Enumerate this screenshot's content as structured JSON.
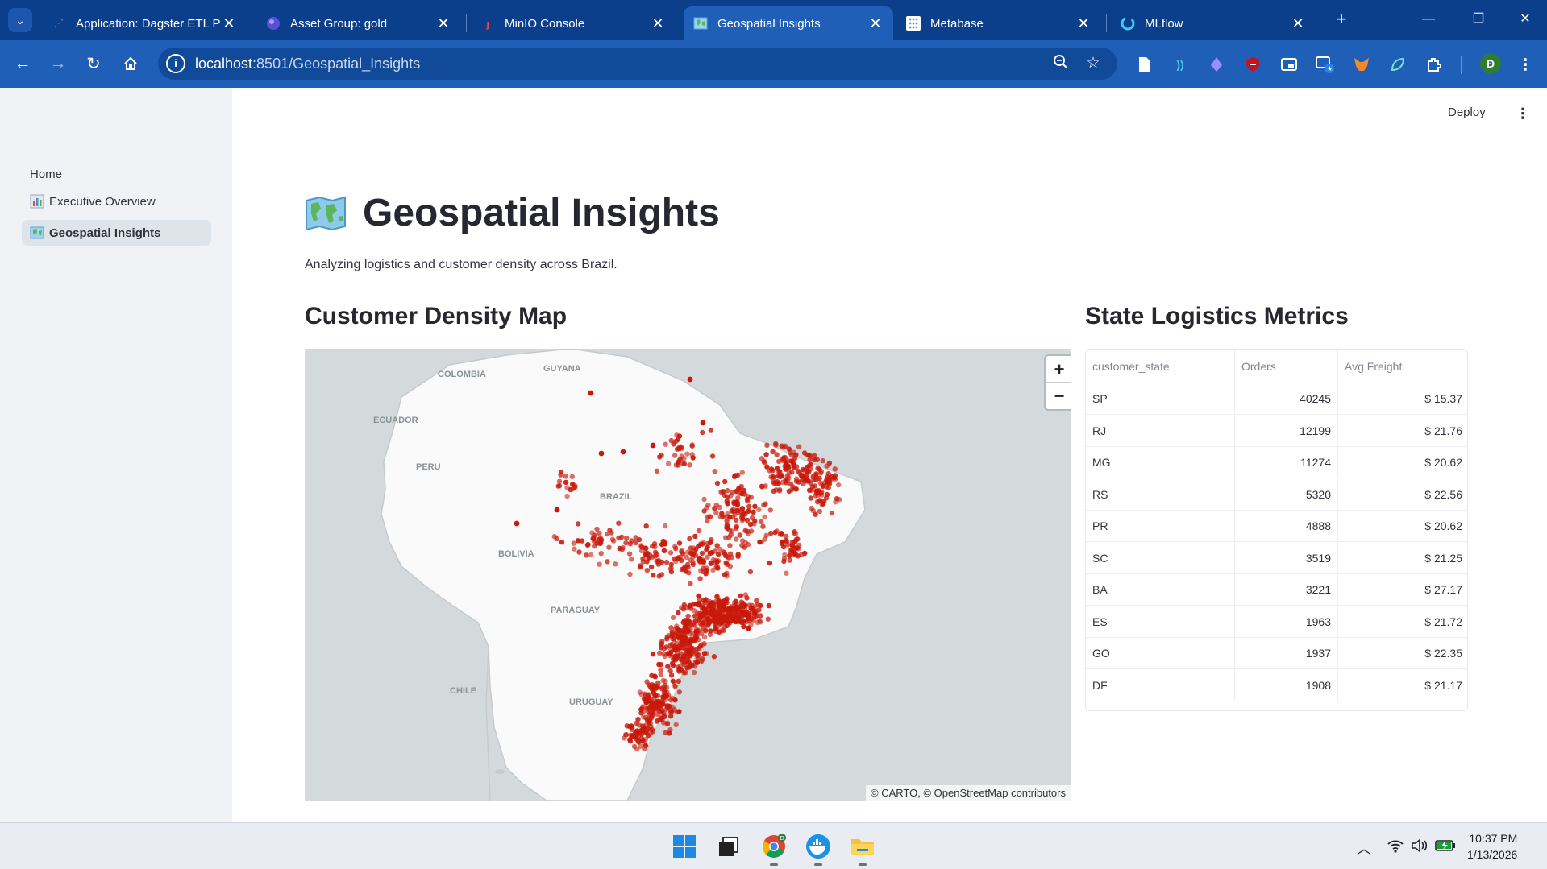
{
  "browser": {
    "tabs": [
      {
        "title": "Application: Dagster ETL Pi",
        "icon": "dagster-icon",
        "active": false
      },
      {
        "title": "Asset Group: gold",
        "icon": "dagster-asset-icon",
        "active": false
      },
      {
        "title": "MinIO Console",
        "icon": "minio-icon",
        "active": false
      },
      {
        "title": "Geospatial Insights",
        "icon": "map-icon",
        "active": true
      },
      {
        "title": "Metabase",
        "icon": "metabase-icon",
        "active": false
      },
      {
        "title": "MLflow",
        "icon": "mlflow-icon",
        "active": false
      }
    ],
    "url_host": "localhost",
    "url_path": ":8501/Geospatial_Insights",
    "profile_initial": "Đ"
  },
  "sidebar": {
    "items": [
      {
        "label": "Home",
        "icon": "",
        "active": false
      },
      {
        "label": "Executive Overview",
        "icon": "bar-chart-icon",
        "active": false
      },
      {
        "label": "Geospatial Insights",
        "icon": "map-icon",
        "active": true
      }
    ]
  },
  "header": {
    "deploy_label": "Deploy"
  },
  "page": {
    "title": "Geospatial Insights",
    "subtitle": "Analyzing logistics and customer density across Brazil."
  },
  "map": {
    "heading": "Customer Density Map",
    "zoom_in": "+",
    "zoom_out": "−",
    "attribution": "© CARTO, © OpenStreetMap contributors",
    "country_labels": [
      "COLOMBIA",
      "GUYANA",
      "ECUADOR",
      "PERU",
      "BRAZIL",
      "BOLIVIA",
      "PARAGUAY",
      "CHILE",
      "URUGUAY"
    ],
    "dot_color": "#c8190b"
  },
  "metrics": {
    "heading": "State Logistics Metrics",
    "columns": [
      "customer_state",
      "Orders",
      "Avg Freight"
    ],
    "rows": [
      [
        "SP",
        "40245",
        "$ 15.37"
      ],
      [
        "RJ",
        "12199",
        "$ 21.76"
      ],
      [
        "MG",
        "11274",
        "$ 20.62"
      ],
      [
        "RS",
        "5320",
        "$ 22.56"
      ],
      [
        "PR",
        "4888",
        "$ 20.62"
      ],
      [
        "SC",
        "3519",
        "$ 21.25"
      ],
      [
        "BA",
        "3221",
        "$ 27.17"
      ],
      [
        "ES",
        "1963",
        "$ 21.72"
      ],
      [
        "GO",
        "1937",
        "$ 22.35"
      ],
      [
        "DF",
        "1908",
        "$ 21.17"
      ]
    ]
  },
  "taskbar": {
    "time": "10:37 PM",
    "date": "1/13/2026"
  }
}
